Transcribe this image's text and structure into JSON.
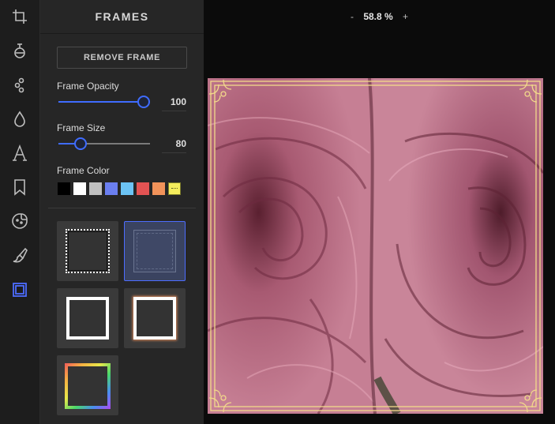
{
  "panel": {
    "title": "FRAMES",
    "remove_button": "REMOVE FRAME",
    "opacity": {
      "label": "Frame Opacity",
      "value": "100",
      "level": 1.0
    },
    "size": {
      "label": "Frame Size",
      "value": "80",
      "level": 0.24
    },
    "color": {
      "label": "Frame Color",
      "swatches": [
        "#000000",
        "#ffffff",
        "#c0c0c0",
        "#6b7ff0",
        "#6cc3f4",
        "#e35353",
        "#f2935a",
        "#f5ed5c"
      ],
      "selected_index": 7
    },
    "frame_styles": [
      "dotted-frame",
      "ornate-frame",
      "white-border-frame",
      "white-glow-frame",
      "gradient-frame"
    ],
    "selected_frame": 1
  },
  "toolbar": {
    "tools": [
      "crop-icon",
      "filter-icon",
      "adjust-icon",
      "drop-icon",
      "text-icon",
      "bookmark-icon",
      "sticker-icon",
      "brush-icon",
      "frame-icon"
    ],
    "active_tool": "frame-icon"
  },
  "canvas": {
    "zoom_minus": "-",
    "zoom_value": "58.8 %",
    "zoom_plus": "+"
  },
  "colors": {
    "accent": "#3f6cff",
    "frame_gold": "#f2d98a"
  }
}
